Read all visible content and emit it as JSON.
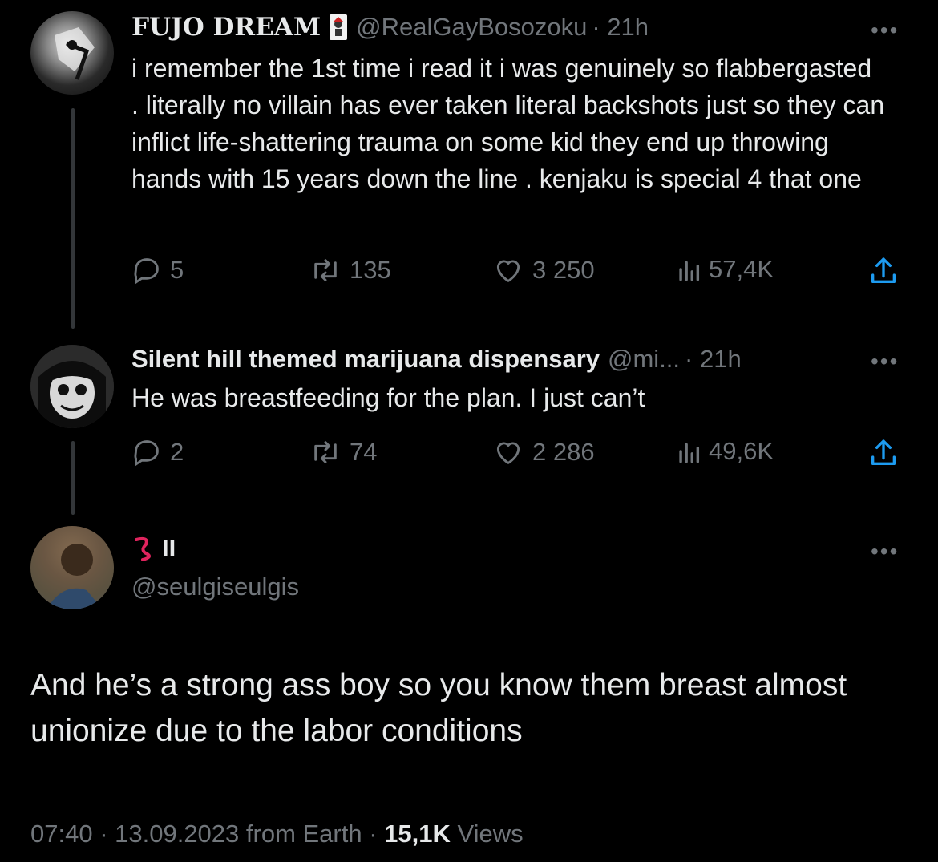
{
  "tweets": [
    {
      "display_name": "FUJO DREAM",
      "handle": "@RealGayBosozoku",
      "time": "· 21h",
      "text": "i remember the 1st time i read it  i was genuinely so flabbergasted . literally no villain has ever taken literal backshots just so they can inflict life-shattering trauma on some kid they end up throwing hands with 15 years down the line . kenjaku is special 4 that one",
      "replies": "5",
      "reposts": "135",
      "likes": "3 250",
      "views": "57,4K",
      "badge_icon": "joker-card-icon"
    },
    {
      "display_name": "Silent hill themed marijuana dispensary",
      "handle": "@mi...",
      "time": "· 21h",
      "text": "He was breastfeeding for the plan. I just can’t",
      "replies": "2",
      "reposts": "74",
      "likes": "2 286",
      "views": "49,6K"
    }
  ],
  "main_tweet": {
    "display_name_icon": "worm-emoji-icon",
    "display_name": "II",
    "handle": "@seulgiseulgis",
    "text": "And he’s a strong ass boy so you know them breast almost unionize due to the labor conditions",
    "time": "07:40 · 13.09.2023 from Earth ·",
    "views_count": "15,1K",
    "views_label": "Views"
  },
  "more_label": "•••",
  "colors": {
    "background": "#000000",
    "text": "#e7e9ea",
    "muted": "#71767b",
    "thread_line": "#333639",
    "worm": "#e0245e"
  }
}
